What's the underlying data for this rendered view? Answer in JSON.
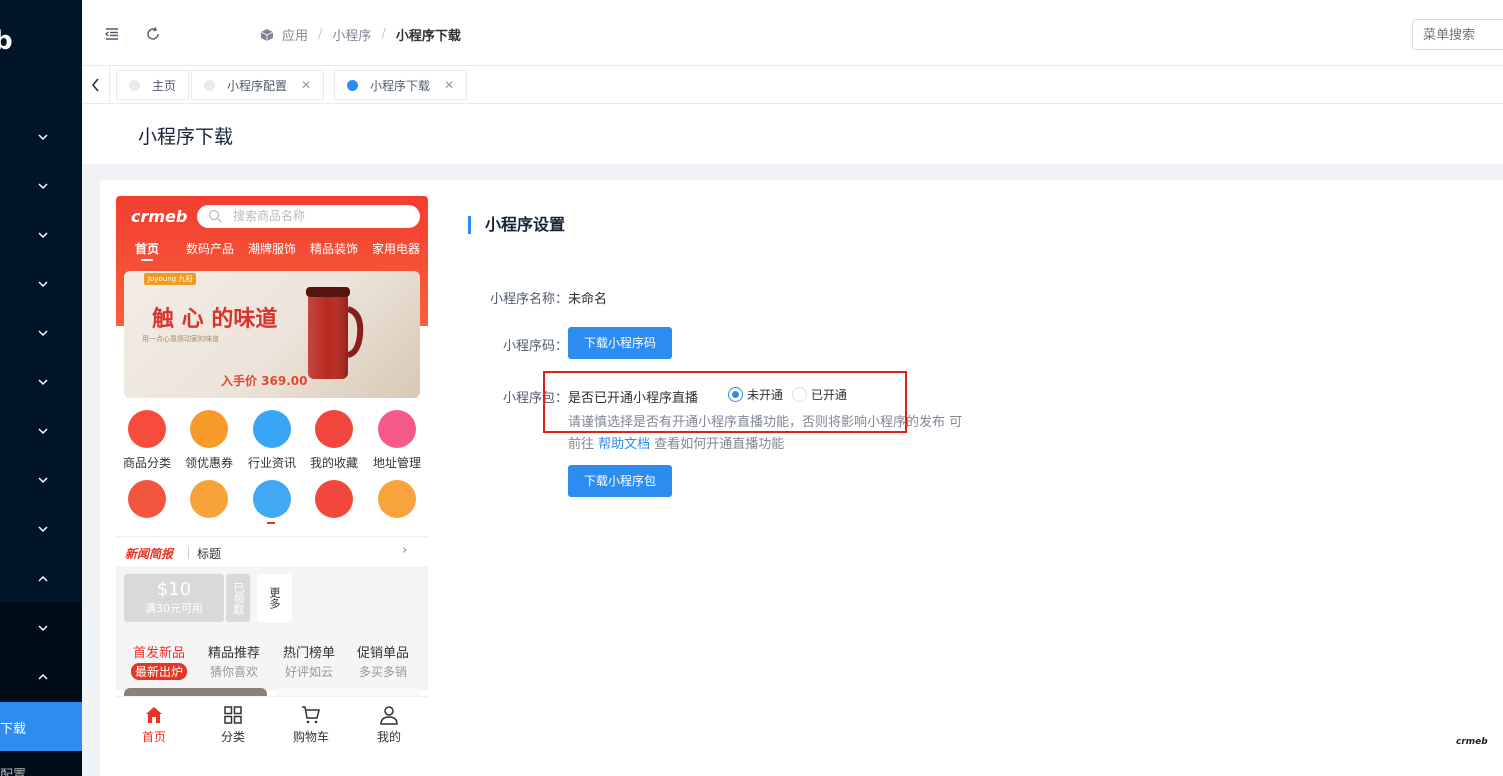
{
  "sidebar": {
    "logo": "b",
    "active_label": "下载",
    "bottom_label": "配置"
  },
  "header": {
    "breadcrumbs": [
      "应用",
      "小程序",
      "小程序下载"
    ],
    "search_placeholder": "菜单搜索"
  },
  "tabs": [
    {
      "label": "主页",
      "closable": false,
      "active": false
    },
    {
      "label": "小程序配置",
      "closable": true,
      "active": false
    },
    {
      "label": "小程序下载",
      "closable": true,
      "active": true
    }
  ],
  "page_title": "小程序下载",
  "preview": {
    "logo": "crmeb",
    "search_placeholder": "搜索商品名称",
    "nav": [
      "首页",
      "数码产品",
      "潮牌服饰",
      "精品装饰",
      "家用电器"
    ],
    "banner": {
      "brand": "Joyoung 九阳",
      "headline": "触 心 的味道",
      "sub": "用一点心意感动家的味道",
      "price": "入手价 369.00"
    },
    "icons": [
      {
        "label": "商品分类",
        "color": "#f74c3c"
      },
      {
        "label": "领优惠券",
        "color": "#f79a2a"
      },
      {
        "label": "行业资讯",
        "color": "#39a6f5"
      },
      {
        "label": "我的收藏",
        "color": "#f0463d"
      },
      {
        "label": "地址管理",
        "color": "#f65a8a"
      },
      {
        "label": "",
        "color": "#f3563f"
      },
      {
        "label": "",
        "color": "#f8a23a"
      },
      {
        "label": "",
        "color": "#41a9f3"
      },
      {
        "label": "",
        "color": "#f2473b"
      },
      {
        "label": "",
        "color": "#f8a33e"
      }
    ],
    "news": {
      "brand": "新闻简报",
      "title": "标题"
    },
    "coupon": {
      "value": "$10",
      "desc": "满30元可用",
      "side": "已领取",
      "more": "更多"
    },
    "cats": [
      {
        "title": "首发新品",
        "sub": "最新出炉"
      },
      {
        "title": "精品推荐",
        "sub": "猜你喜欢"
      },
      {
        "title": "热门榜单",
        "sub": "好评如云"
      },
      {
        "title": "促销单品",
        "sub": "多买多销"
      }
    ],
    "tabbar": [
      "首页",
      "分类",
      "购物车",
      "我的"
    ]
  },
  "settings": {
    "section_title": "小程序设置",
    "name_label": "小程序名称：",
    "name_value": "未命名",
    "code_label": "小程序码：",
    "code_button": "下载小程序码",
    "pkg_label": "小程序包：",
    "live_question": "是否已开通小程序直播",
    "radio_off": "未开通",
    "radio_on": "已开通",
    "radio_selected": "未开通",
    "tip_before": "请谨慎选择是否有开通小程序直播功能，否则将影响小程序的发布 可前往 ",
    "tip_link": "帮助文档",
    "tip_after": " 查看如何开通直播功能",
    "pkg_button": "下载小程序包"
  },
  "watermark": "crmeb",
  "colors": {
    "primary": "#2d8cf0",
    "sidebar": "#001529",
    "accent_red": "#e93323"
  }
}
